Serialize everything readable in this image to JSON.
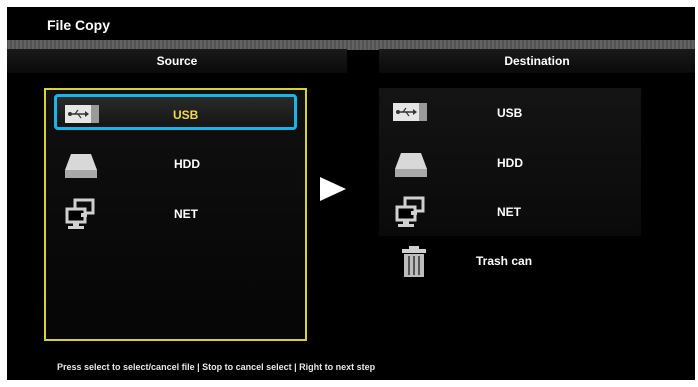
{
  "window": {
    "title": "File Copy"
  },
  "headers": {
    "source": "Source",
    "destination": "Destination"
  },
  "source": {
    "items": [
      {
        "label": "USB",
        "icon": "usb-icon",
        "selected": true
      },
      {
        "label": "HDD",
        "icon": "hdd-icon"
      },
      {
        "label": "NET",
        "icon": "network-icon"
      }
    ]
  },
  "destination": {
    "items": [
      {
        "label": "USB",
        "icon": "usb-icon"
      },
      {
        "label": "HDD",
        "icon": "hdd-icon"
      },
      {
        "label": "NET",
        "icon": "network-icon"
      },
      {
        "label": "Trash can",
        "icon": "trash-icon"
      }
    ]
  },
  "hint": "Press select to select/cancel file | Stop to cancel select | Right to next step",
  "colors": {
    "selection_border": "#1bb4e8",
    "source_panel_border": "#d8d23a",
    "selected_text": "#f1d94c"
  }
}
